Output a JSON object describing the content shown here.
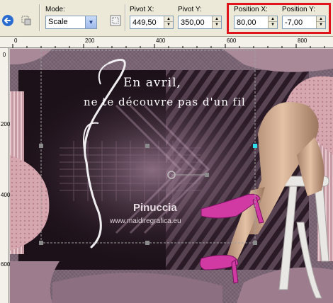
{
  "toolbar": {
    "mode_label": "Mode:",
    "mode_value": "Scale",
    "pivot_x_label": "Pivot X:",
    "pivot_x_value": "449,50",
    "pivot_y_label": "Pivot Y:",
    "pivot_y_value": "350,00",
    "position_x_label": "Position X:",
    "position_x_value": "80,00",
    "position_y_label": "Position Y:",
    "position_y_value": "-7,00",
    "highlight_color": "#e0141b"
  },
  "ruler_top": {
    "labels": [
      "0",
      "200",
      "400",
      "600",
      "800"
    ]
  },
  "ruler_left": {
    "labels": [
      "0",
      "200",
      "400",
      "600"
    ]
  },
  "canvas": {
    "title_line1": "En avril,",
    "title_line2": "ne te découvre pas d'un fil",
    "signature": "Pinuccia",
    "website": "www.maidiregrafica.eu",
    "accent_color": "#d23aa3"
  }
}
